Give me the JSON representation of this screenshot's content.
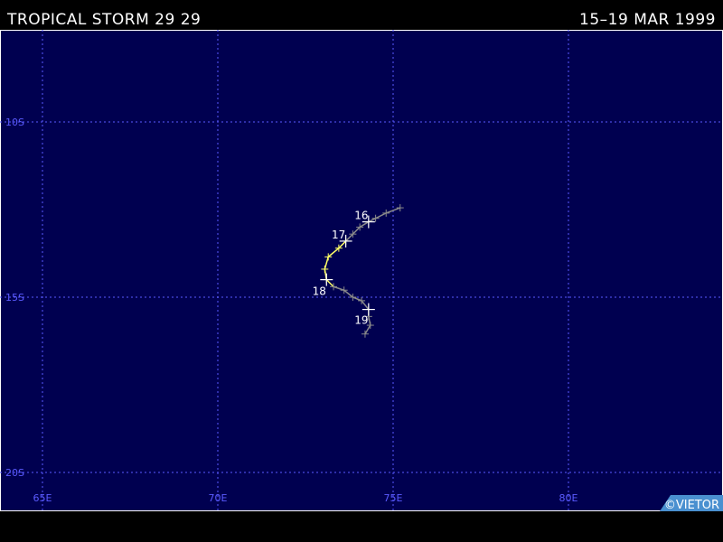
{
  "header": {
    "title": "TROPICAL STORM 29 29",
    "dates": "15–19 MAR 1999"
  },
  "map": {
    "background_color": "#000050",
    "grid_color": "#5a5aff",
    "lat_labels": [
      "10S",
      "15S",
      "20S"
    ],
    "lon_labels": [
      "65E",
      "70E",
      "75E",
      "80E"
    ],
    "lat_values": [
      -10,
      -15,
      -20
    ],
    "lon_values": [
      65,
      70,
      75,
      80
    ]
  },
  "track": {
    "colors": {
      "weak": "#8a8a8a",
      "storm": "#ffff66",
      "marker": "#ffffff"
    },
    "points": [
      {
        "lon": 75.2,
        "lat": -12.45,
        "cls": "weak"
      },
      {
        "lon": 74.8,
        "lat": -12.6,
        "cls": "weak"
      },
      {
        "lon": 74.5,
        "lat": -12.75,
        "cls": "weak"
      },
      {
        "lon": 74.3,
        "lat": -12.85,
        "cls": "weak"
      },
      {
        "lon": 74.05,
        "lat": -13.0,
        "cls": "weak"
      },
      {
        "lon": 73.85,
        "lat": -13.2,
        "cls": "weak"
      },
      {
        "lon": 73.65,
        "lat": -13.4,
        "cls": "storm"
      },
      {
        "lon": 73.45,
        "lat": -13.6,
        "cls": "storm"
      },
      {
        "lon": 73.15,
        "lat": -13.85,
        "cls": "storm"
      },
      {
        "lon": 73.05,
        "lat": -14.2,
        "cls": "storm"
      },
      {
        "lon": 73.1,
        "lat": -14.5,
        "cls": "storm"
      },
      {
        "lon": 73.3,
        "lat": -14.7,
        "cls": "weak"
      },
      {
        "lon": 73.6,
        "lat": -14.8,
        "cls": "weak"
      },
      {
        "lon": 73.85,
        "lat": -15.0,
        "cls": "weak"
      },
      {
        "lon": 74.1,
        "lat": -15.1,
        "cls": "weak"
      },
      {
        "lon": 74.3,
        "lat": -15.35,
        "cls": "weak"
      },
      {
        "lon": 74.3,
        "lat": -15.55,
        "cls": "weak"
      },
      {
        "lon": 74.35,
        "lat": -15.8,
        "cls": "weak"
      },
      {
        "lon": 74.2,
        "lat": -16.05,
        "cls": "weak"
      }
    ],
    "day_markers": [
      {
        "label": "16",
        "lon": 74.3,
        "lat": -12.85
      },
      {
        "label": "17",
        "lon": 73.65,
        "lat": -13.4
      },
      {
        "label": "18",
        "lon": 73.1,
        "lat": -14.5
      },
      {
        "label": "19",
        "lon": 74.3,
        "lat": -15.35
      }
    ]
  },
  "credit": "©VIETOR"
}
